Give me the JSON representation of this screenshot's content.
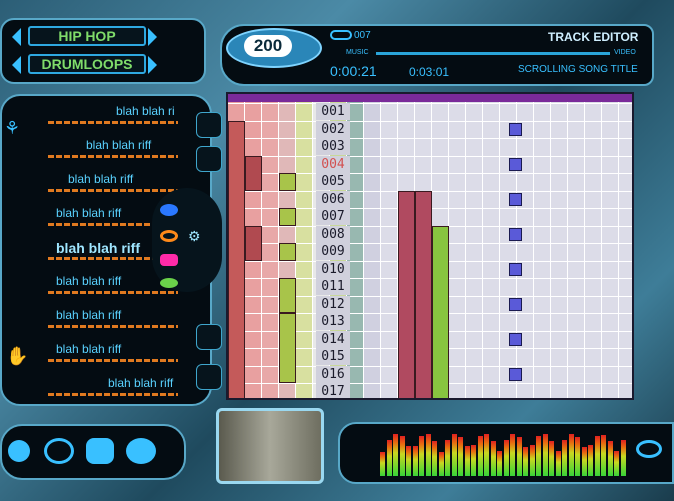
{
  "genre": {
    "primary": "HIP HOP",
    "secondary": "DRUMLOOPS"
  },
  "display": {
    "tempo": "200",
    "track_number": "007",
    "mode_title": "TRACK EDITOR",
    "music_label": "MUSIC",
    "video_label": "VIDEO",
    "elapsed": "0:00:21",
    "total": "0:03:01",
    "song_title": "SCROLLING SONG TITLE"
  },
  "riffs": [
    {
      "label": "blah blah ri"
    },
    {
      "label": "blah blah riff"
    },
    {
      "label": "blah blah riff"
    },
    {
      "label": "blah blah riff"
    },
    {
      "label": "blah blah riff",
      "selected": true
    },
    {
      "label": "blah blah riff"
    },
    {
      "label": "blah blah riff"
    },
    {
      "label": "blah blah riff"
    },
    {
      "label": "blah blah riff"
    }
  ],
  "rows": [
    "001",
    "002",
    "003",
    "004",
    "005",
    "006",
    "007",
    "008",
    "009",
    "010",
    "011",
    "012",
    "013",
    "014",
    "015",
    "016",
    "017"
  ],
  "highlighted_row": "004",
  "colors": {
    "accent": "#39c0ff",
    "genre_text": "#7fdc6a",
    "riff_text": "#5ad2ff",
    "dash": "#e07a20",
    "grid_header": "#7a2a9a"
  },
  "icons": [
    "ufo-icon",
    "tornado-icon",
    "drum-icon",
    "disc-icon",
    "hand-icon",
    "pad-icon",
    "loop-icon",
    "play-icon",
    "eye-icon",
    "mouth-icon",
    "wave-icon"
  ]
}
